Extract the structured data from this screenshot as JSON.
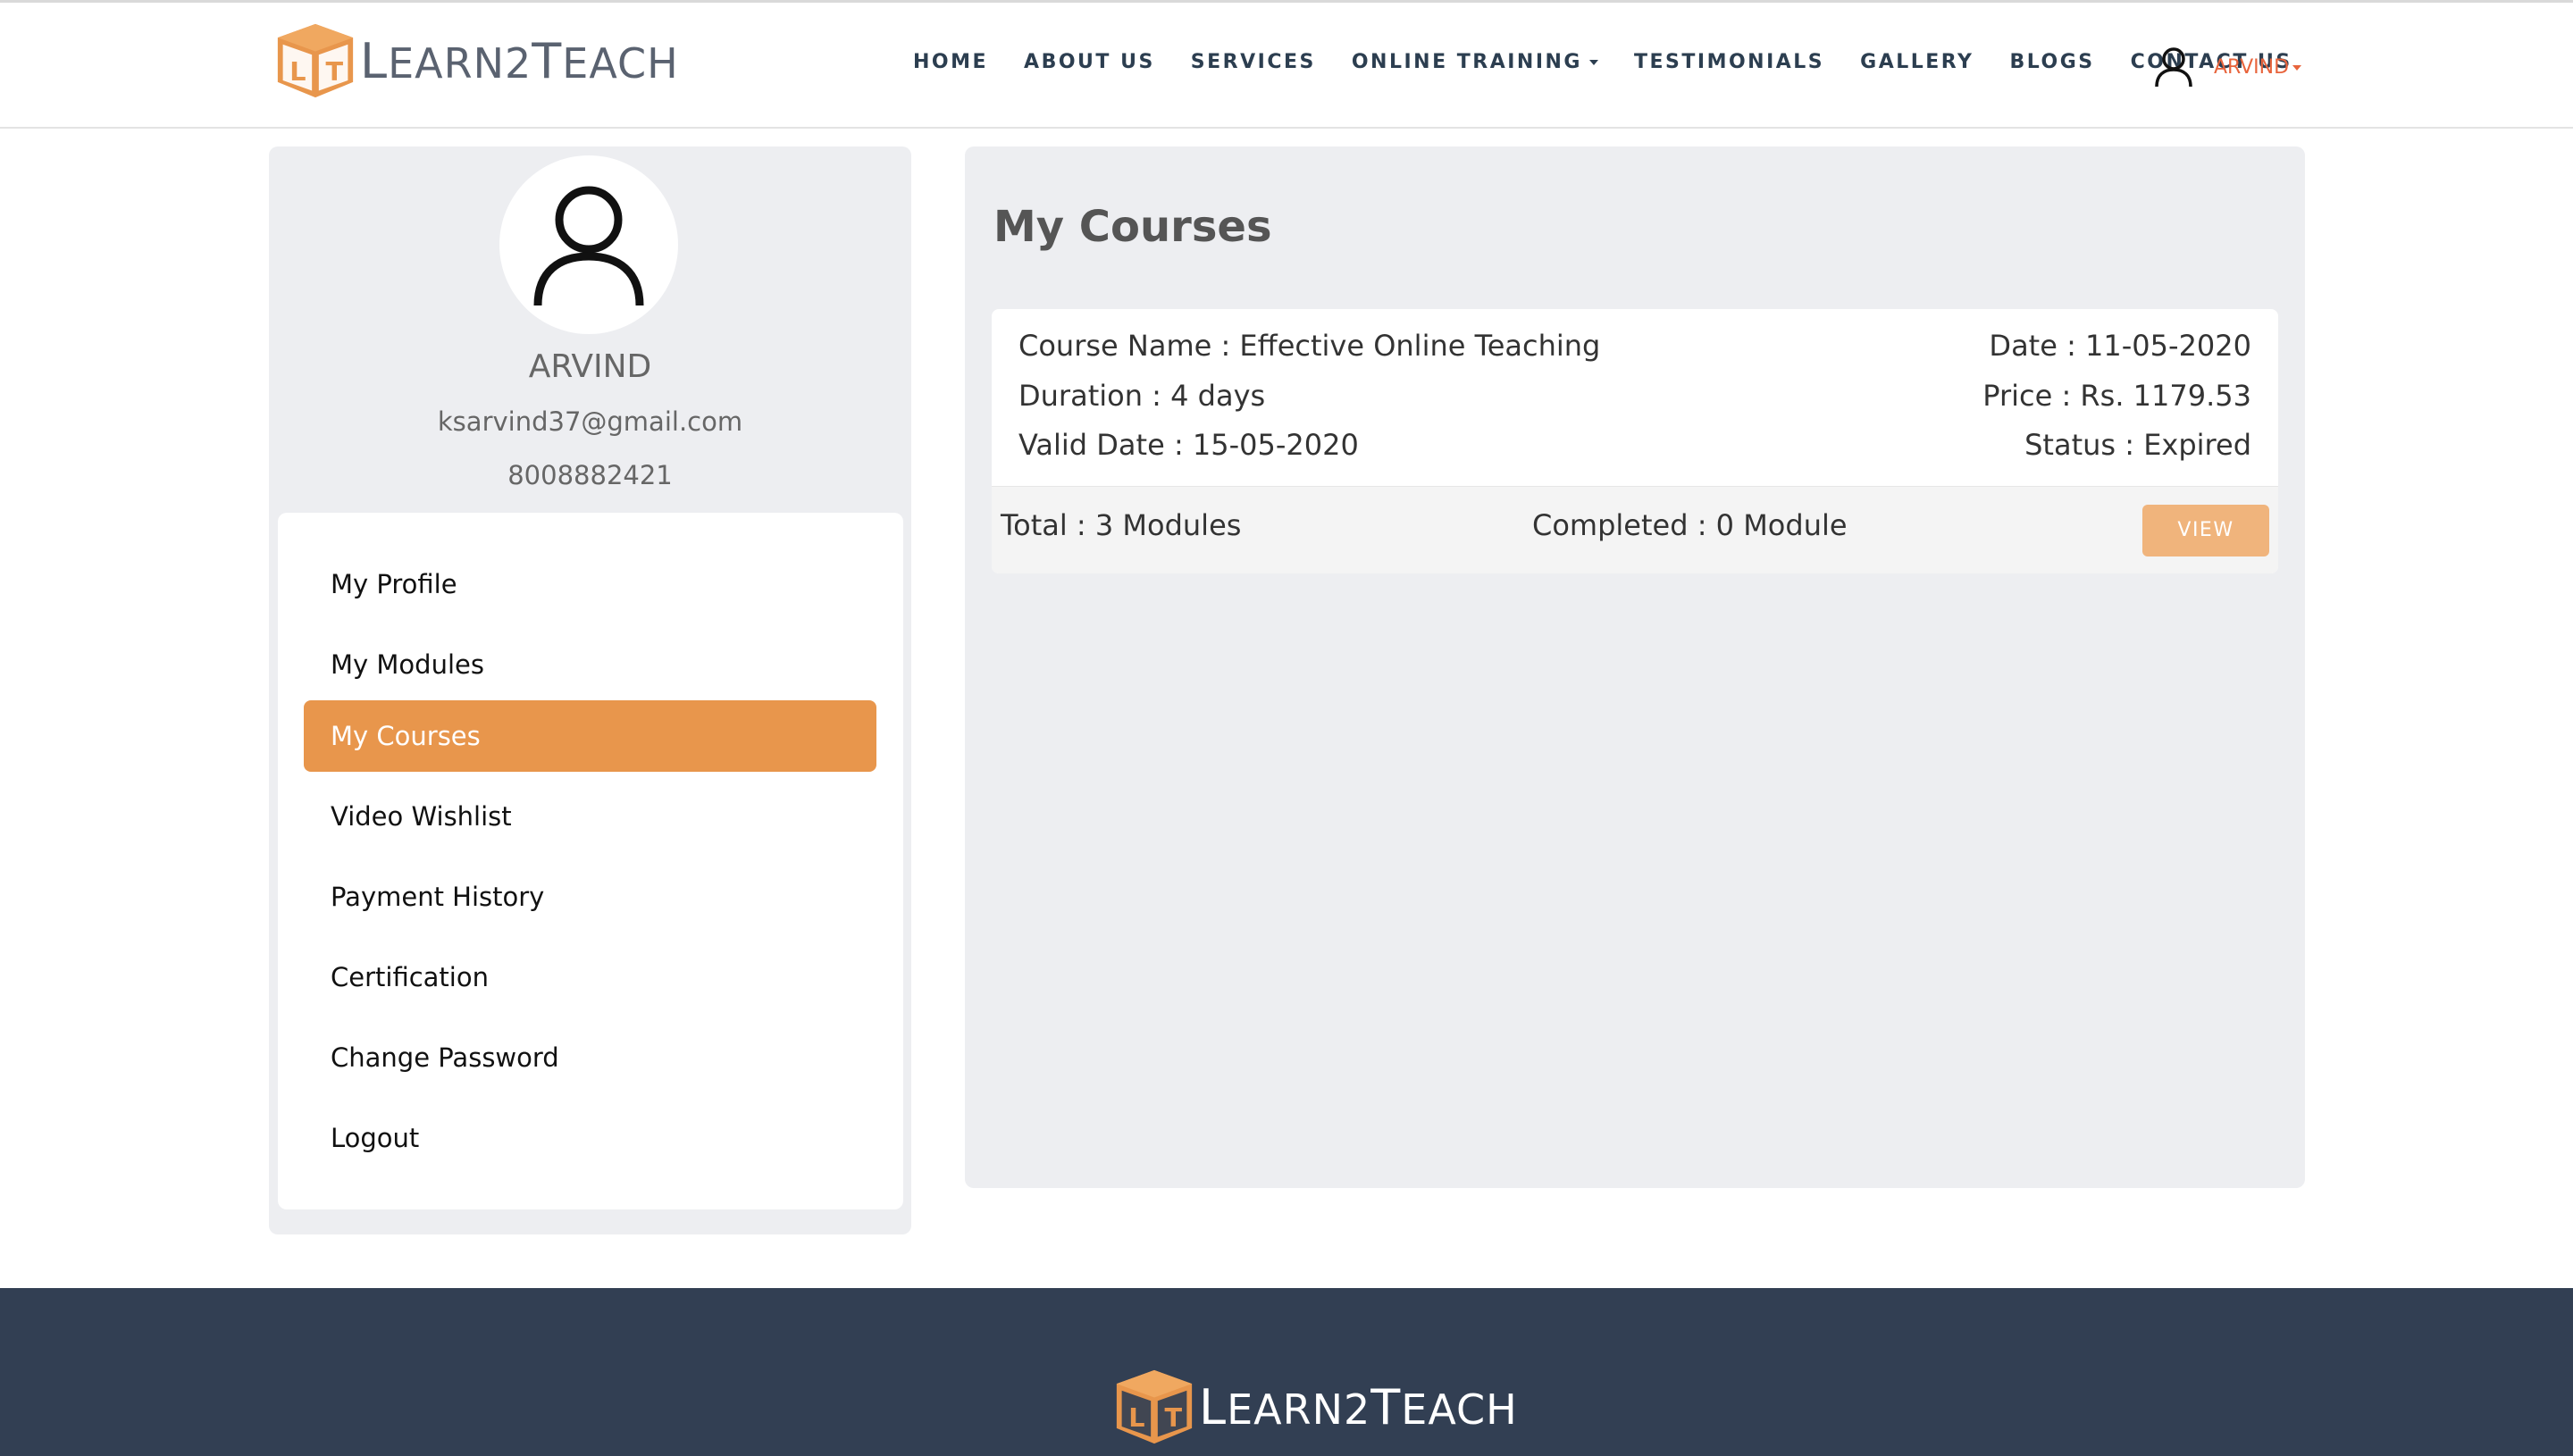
{
  "header": {
    "logo": {
      "text_prefix_cap": "L",
      "text_prefix": "EARN2",
      "text_suffix_cap": "T",
      "text_suffix": "EACH",
      "badge_letters": [
        "L",
        "T"
      ]
    },
    "nav": [
      {
        "label": "HOME"
      },
      {
        "label": "ABOUT US"
      },
      {
        "label": "SERVICES"
      },
      {
        "label": "ONLINE TRAINING",
        "has_dropdown": true
      },
      {
        "label": "TESTIMONIALS"
      },
      {
        "label": "GALLERY"
      },
      {
        "label": "BLOGS"
      },
      {
        "label": "CONTACT US"
      }
    ],
    "user": {
      "name": "ARVIND",
      "icon": "user-icon"
    }
  },
  "profile": {
    "name": "ARVIND",
    "email": "ksarvind37@gmail.com",
    "phone": "8008882421",
    "menu": [
      {
        "label": "My Profile",
        "active": false
      },
      {
        "label": "My Modules",
        "active": false
      },
      {
        "label": "My Courses",
        "active": true
      },
      {
        "label": "Video Wishlist",
        "active": false
      },
      {
        "label": "Payment History",
        "active": false
      },
      {
        "label": "Certification",
        "active": false
      },
      {
        "label": "Change Password",
        "active": false
      },
      {
        "label": "Logout",
        "active": false
      }
    ]
  },
  "main": {
    "title": "My Courses",
    "course": {
      "name": "Course Name : Effective Online Teaching",
      "duration": "Duration : 4 days",
      "valid_date": "Valid Date : 15-05-2020",
      "date": "Date : 11-05-2020",
      "price": "Price : Rs. 1179.53",
      "status": "Status : Expired",
      "total": "Total : 3 Modules",
      "completed": "Completed : 0 Module",
      "view_label": "VIEW"
    }
  },
  "colors": {
    "accent": "#e8964c",
    "view_button": "#f0b47c",
    "user_name": "#e8643c",
    "footer_bg": "#323f53",
    "panel_bg": "#edeef1"
  }
}
